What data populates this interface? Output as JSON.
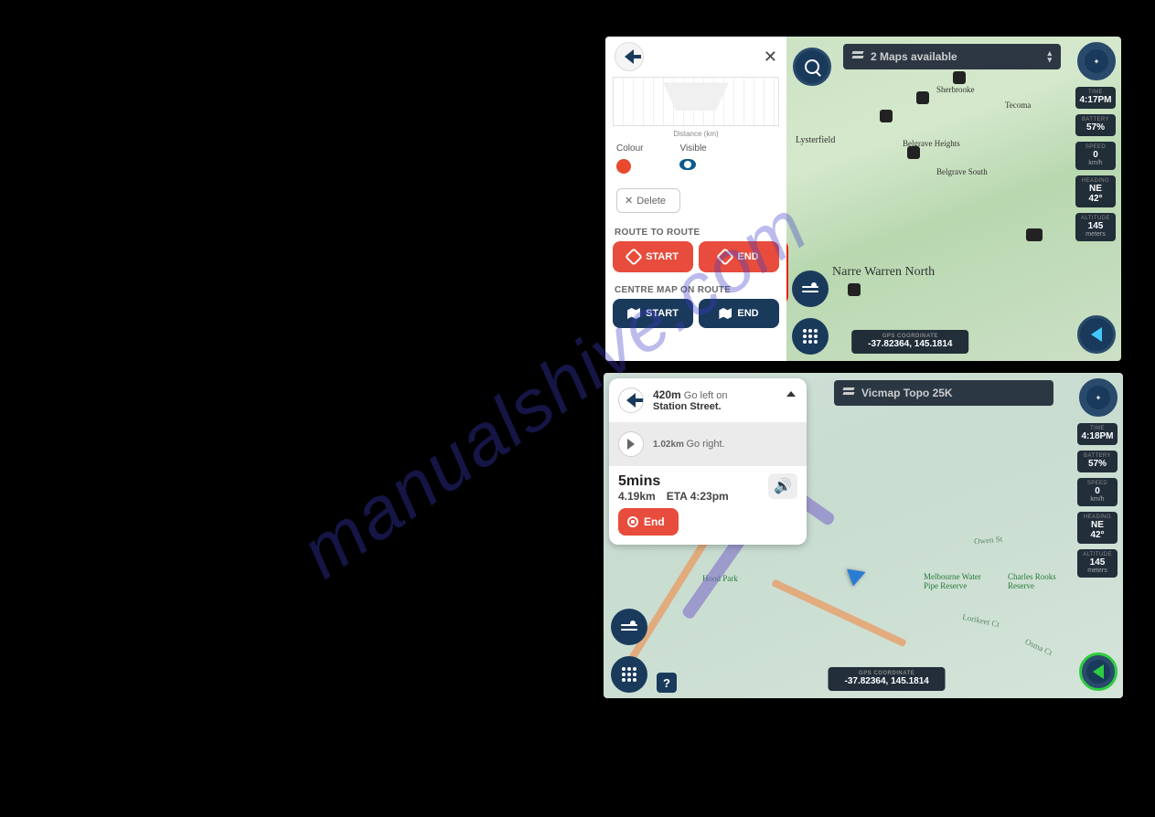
{
  "watermark": "manualshive.com",
  "shot1": {
    "top_dropdown": "2 Maps available",
    "panel": {
      "elev_dist_label": "Distance (km)",
      "colour_label": "Colour",
      "visible_label": "Visible",
      "delete_label": "Delete",
      "route_to_route_label": "ROUTE TO ROUTE",
      "route_start": "START",
      "route_end": "END",
      "centre_label": "CENTRE MAP ON ROUTE",
      "centre_start": "START",
      "centre_end": "END"
    },
    "status": {
      "time_label": "TIME",
      "time_value": "4:17PM",
      "battery_label": "BATTERY",
      "battery_value": "57%",
      "speed_label": "SPEED",
      "speed_value": "0",
      "speed_unit": "km/h",
      "heading_label": "HEADING",
      "heading_value": "NE",
      "heading_deg": "42°",
      "altitude_label": "ALTITUDE",
      "altitude_value": "145",
      "altitude_unit": "meters"
    },
    "gps_label": "GPS COORDINATE",
    "gps_value": "-37.82364, 145.1814",
    "map_places": {
      "lysterfield": "Lysterfield",
      "belgrave_hts": "Belgrave Heights",
      "belgrave_sth": "Belgrave South",
      "narre": "Narre Warren North",
      "sherbrooke": "Sherbrooke",
      "tecoma": "Tecoma"
    }
  },
  "shot2": {
    "top_dropdown": "Vicmap Topo 25K",
    "nav": {
      "step1_dist": "420m",
      "step1_dir": "Go left on",
      "step1_road": "Station Street.",
      "step2_dist": "1.02km",
      "step2_dir": "Go right.",
      "time": "5mins",
      "distance": "4.19km",
      "eta": "ETA 4:23pm",
      "end": "End"
    },
    "status": {
      "time_label": "TIME",
      "time_value": "4:18PM",
      "battery_label": "BATTERY",
      "battery_value": "57%",
      "speed_label": "SPEED",
      "speed_value": "0",
      "speed_unit": "km/h",
      "heading_label": "HEADING",
      "heading_value": "NE",
      "heading_deg": "42°",
      "altitude_label": "ALTITUDE",
      "altitude_value": "145",
      "altitude_unit": "meters"
    },
    "gps_label": "GPS COORDINATE",
    "gps_value": "-37.82364, 145.1814",
    "help": "?",
    "map_places": {
      "hood_park": "Hood Park",
      "reserve": "Melbourne Water Pipe Reserve",
      "charles": "Charles Rooks Reserve",
      "lorikeet": "Lorikeet Ct",
      "osma": "Osma Ct",
      "owen": "Owen St"
    }
  }
}
